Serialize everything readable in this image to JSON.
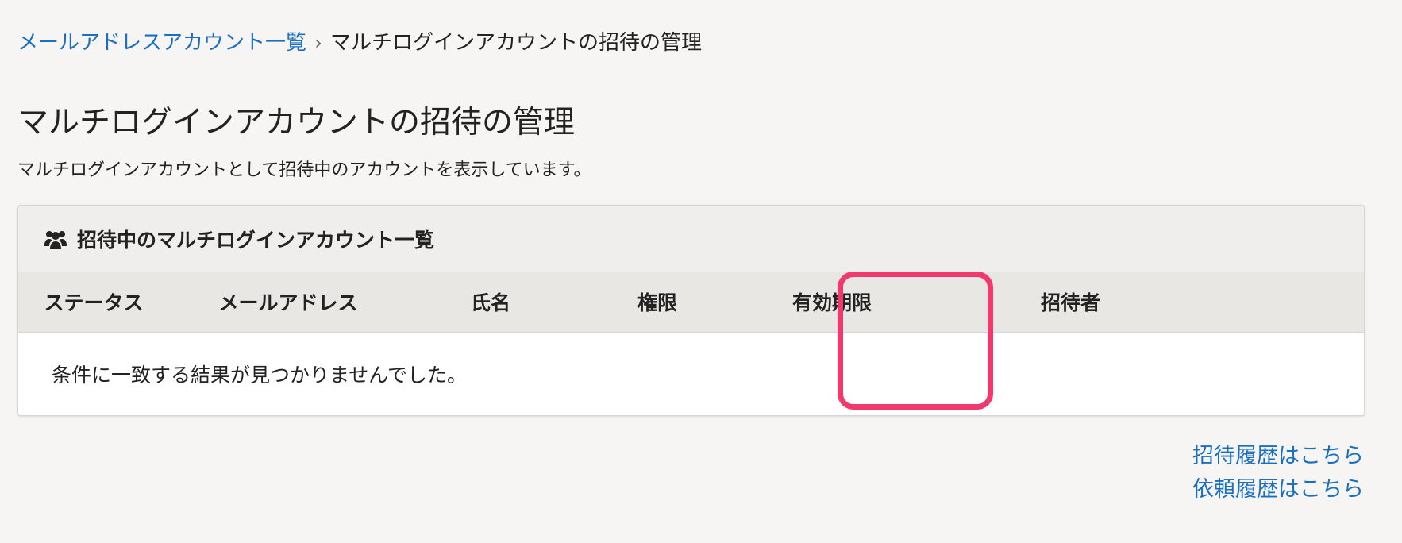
{
  "breadcrumb": {
    "parent": "メールアドレスアカウント一覧",
    "separator": "›",
    "current": "マルチログインアカウントの招待の管理"
  },
  "page": {
    "title": "マルチログインアカウントの招待の管理",
    "description": "マルチログインアカウントとして招待中のアカウントを表示しています。"
  },
  "panel": {
    "icon": "users-icon",
    "title": "招待中のマルチログインアカウント一覧",
    "columns": [
      "ステータス",
      "メールアドレス",
      "氏名",
      "権限",
      "有効期限",
      "招待者"
    ],
    "empty_message": "条件に一致する結果が見つかりませんでした。"
  },
  "links": {
    "invite_history": "招待履歴はこちら",
    "request_history": "依頼履歴はこちら"
  },
  "colors": {
    "link": "#1a6fbf",
    "highlight": "#f03a6e",
    "background": "#f6f5f4"
  }
}
